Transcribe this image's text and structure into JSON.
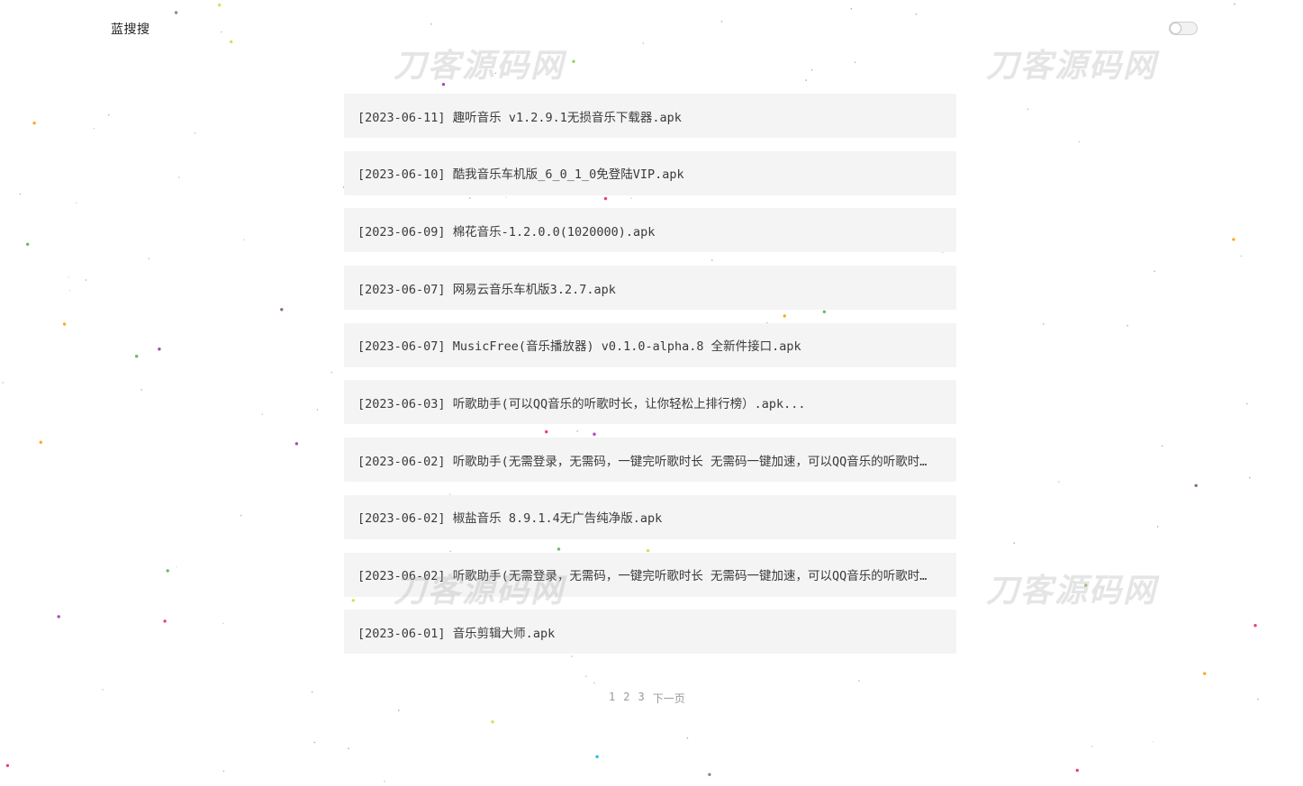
{
  "header": {
    "brand": "蓝搜搜"
  },
  "watermark": {
    "text": "刀客源码网"
  },
  "results": [
    {
      "date": "[2023-06-11]",
      "title": "趣听音乐 v1.2.9.1无损音乐下载器.apk"
    },
    {
      "date": "[2023-06-10]",
      "title": "酷我音乐车机版_6_0_1_0免登陆VIP.apk"
    },
    {
      "date": "[2023-06-09]",
      "title": "棉花音乐-1.2.0.0(1020000).apk"
    },
    {
      "date": "[2023-06-07]",
      "title": "网易云音乐车机版3.2.7.apk"
    },
    {
      "date": "[2023-06-07]",
      "title": "MusicFree(音乐播放器) v0.1.0-alpha.8 全新件接口.apk"
    },
    {
      "date": "[2023-06-03]",
      "title": "听歌助手(可以QQ音乐的听歌时长，让你轻松上排行榜）.apk..."
    },
    {
      "date": "[2023-06-02]",
      "title": "听歌助手(无需登录，无需码，一键完听歌时长 无需码一键加速，可以QQ音乐的听歌时长).apk"
    },
    {
      "date": "[2023-06-02]",
      "title": "椒盐音乐 8.9.1.4无广告纯净版.apk"
    },
    {
      "date": "[2023-06-02]",
      "title": "听歌助手(无需登录，无需码，一键完听歌时长 无需码一键加速，可以QQ音乐的听歌时长).apk"
    },
    {
      "date": "[2023-06-01]",
      "title": "音乐剪辑大师.apk"
    }
  ],
  "pagination": {
    "pages": [
      "1",
      "2",
      "3"
    ],
    "next": "下一页"
  }
}
